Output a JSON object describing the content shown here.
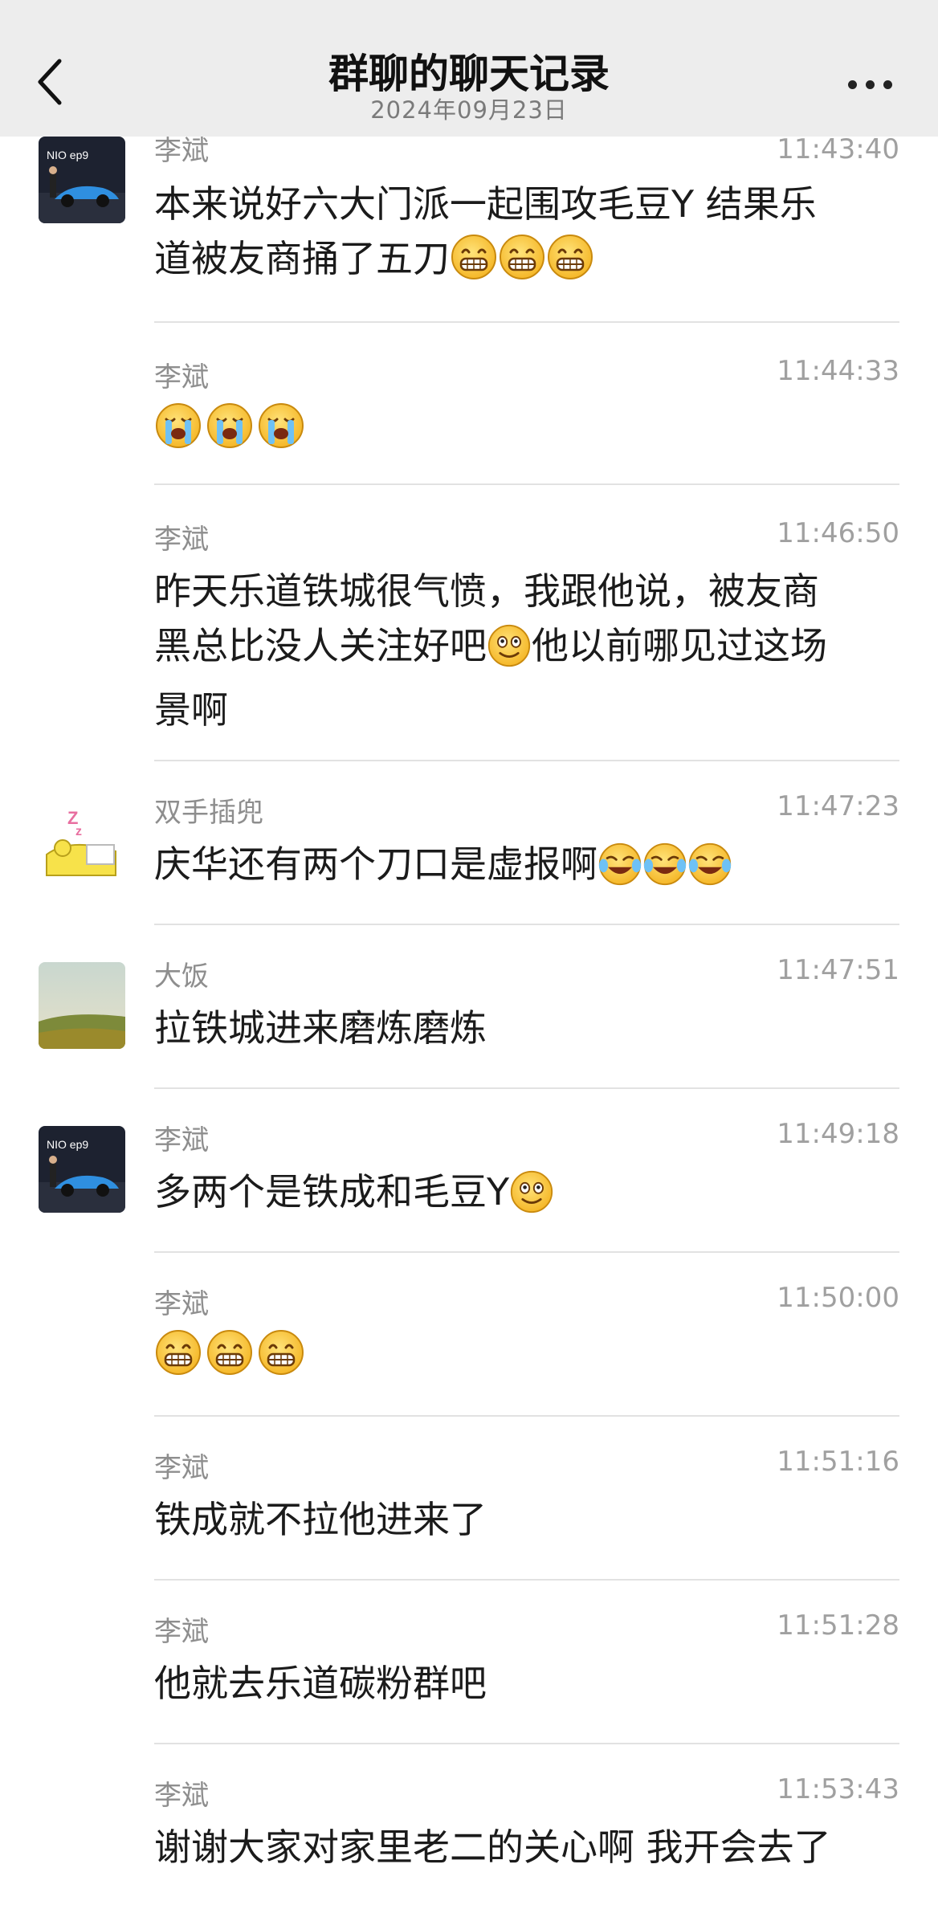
{
  "header": {
    "title": "群聊的聊天记录",
    "date": "2024年09月23日",
    "back_icon": "chevron-left-icon",
    "more_icon": "more-dots-icon"
  },
  "messages": [
    {
      "sender": "李斌",
      "time": "11:43:40",
      "text": "本来说好六大门派一起围攻毛豆Y 结果乐\n道被友商捅了五刀",
      "emoji": "grin-emoji",
      "emoji_count": 3,
      "avatar": "car-photo-avatar"
    },
    {
      "sender": "李斌",
      "time": "11:44:33",
      "text": "",
      "emoji": "cry-emoji",
      "emoji_count": 3
    },
    {
      "sender": "李斌",
      "time": "11:46:50",
      "text": "昨天乐道铁城很气愤，我跟他说，被友商\n黑总比没人关注好吧",
      "text_after": "他以前哪见过这场\n景啊",
      "emoji": "smile-emoji"
    },
    {
      "sender": "双手插兜",
      "time": "11:47:23",
      "text": "庆华还有两个刀口是虚报啊",
      "emoji": "laugh-cry-emoji",
      "emoji_count": 3,
      "avatar": "sleeping-cartoon-avatar"
    },
    {
      "sender": "大饭",
      "time": "11:47:51",
      "text": "拉铁城进来磨炼磨炼",
      "avatar": "landscape-avatar"
    },
    {
      "sender": "李斌",
      "time": "11:49:18",
      "text": "多两个是铁成和毛豆Y",
      "emoji": "smile-emoji",
      "avatar": "car-photo-avatar"
    },
    {
      "sender": "李斌",
      "time": "11:50:00",
      "text": "",
      "emoji": "grin-emoji",
      "emoji_count": 3
    },
    {
      "sender": "李斌",
      "time": "11:51:16",
      "text": "铁成就不拉他进来了"
    },
    {
      "sender": "李斌",
      "time": "11:51:28",
      "text": "他就去乐道碳粉群吧"
    },
    {
      "sender": "李斌",
      "time": "11:53:43",
      "text": "谢谢大家对家里老二的关心啊 我开会去了"
    }
  ],
  "colors": {
    "header_bg": "#ededed",
    "sender": "#8e8e8e",
    "time": "#a0a0a0",
    "divider": "#e2e2e2"
  }
}
